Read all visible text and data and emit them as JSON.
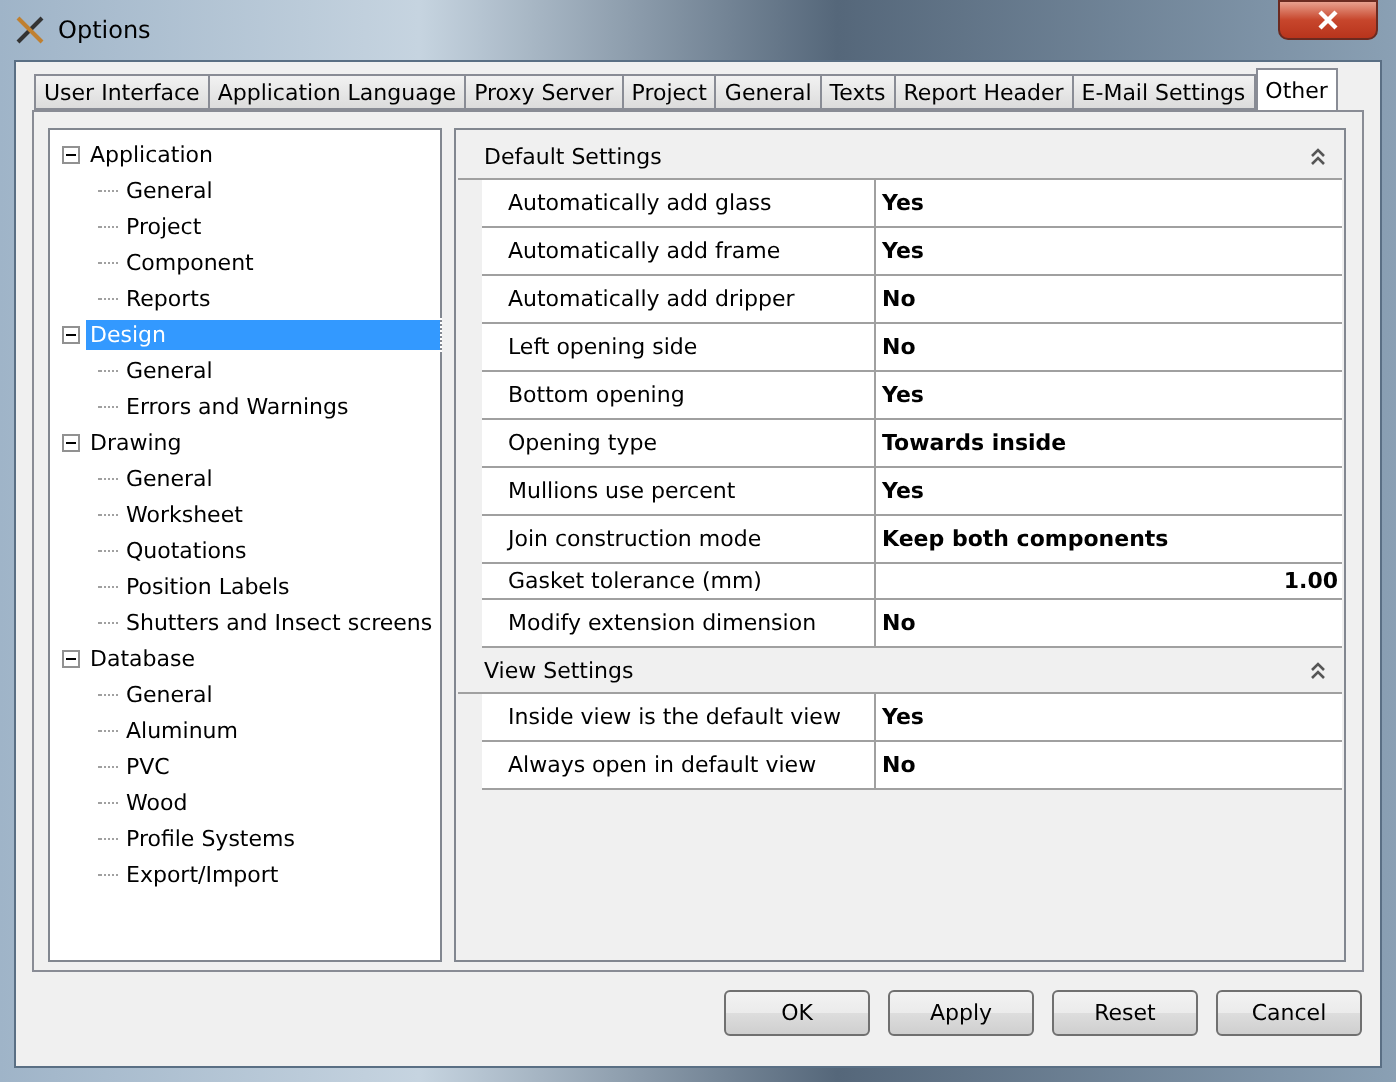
{
  "window": {
    "title": "Options"
  },
  "tabs": [
    {
      "label": "User Interface",
      "selected": false
    },
    {
      "label": "Application Language",
      "selected": false
    },
    {
      "label": "Proxy Server",
      "selected": false
    },
    {
      "label": "Project",
      "selected": false
    },
    {
      "label": "General",
      "selected": false
    },
    {
      "label": "Texts",
      "selected": false
    },
    {
      "label": "Report Header",
      "selected": false
    },
    {
      "label": "E-Mail Settings",
      "selected": false
    },
    {
      "label": "Other",
      "selected": true
    }
  ],
  "tree": [
    {
      "label": "Application",
      "expanded": true,
      "selected": false,
      "children": [
        {
          "label": "General",
          "selected": false
        },
        {
          "label": "Project",
          "selected": false
        },
        {
          "label": "Component",
          "selected": false
        },
        {
          "label": "Reports",
          "selected": false
        }
      ]
    },
    {
      "label": "Design",
      "expanded": true,
      "selected": true,
      "children": [
        {
          "label": "General",
          "selected": false
        },
        {
          "label": "Errors and Warnings",
          "selected": false
        }
      ]
    },
    {
      "label": "Drawing",
      "expanded": true,
      "selected": false,
      "children": [
        {
          "label": "General",
          "selected": false
        },
        {
          "label": "Worksheet",
          "selected": false
        },
        {
          "label": "Quotations",
          "selected": false
        },
        {
          "label": "Position Labels",
          "selected": false
        },
        {
          "label": "Shutters and Insect screens",
          "selected": false
        }
      ]
    },
    {
      "label": "Database",
      "expanded": true,
      "selected": false,
      "children": [
        {
          "label": "General",
          "selected": false
        },
        {
          "label": "Aluminum",
          "selected": false
        },
        {
          "label": "PVC",
          "selected": false
        },
        {
          "label": "Wood",
          "selected": false
        },
        {
          "label": "Profile Systems",
          "selected": false
        },
        {
          "label": "Export/Import",
          "selected": false
        }
      ]
    }
  ],
  "property_grid": [
    {
      "title": "Default Settings",
      "expanded": true,
      "rows": [
        {
          "name": "Automatically add glass",
          "value": "Yes",
          "kind": "text"
        },
        {
          "name": "Automatically add frame",
          "value": "Yes",
          "kind": "text"
        },
        {
          "name": "Automatically add dripper",
          "value": "No",
          "kind": "text"
        },
        {
          "name": "Left opening side",
          "value": "No",
          "kind": "text"
        },
        {
          "name": "Bottom opening",
          "value": "Yes",
          "kind": "text"
        },
        {
          "name": "Opening type",
          "value": "Towards inside",
          "kind": "text"
        },
        {
          "name": "Mullions use percent",
          "value": "Yes",
          "kind": "text"
        },
        {
          "name": "Join construction mode",
          "value": "Keep both components",
          "kind": "text"
        },
        {
          "name": "Gasket tolerance (mm)",
          "value": "1.00",
          "kind": "number"
        },
        {
          "name": "Modify extension dimension",
          "value": "No",
          "kind": "text"
        }
      ]
    },
    {
      "title": "View Settings",
      "expanded": true,
      "rows": [
        {
          "name": "Inside view is the default view",
          "value": "Yes",
          "kind": "text"
        },
        {
          "name": "Always open in default view",
          "value": "No",
          "kind": "text"
        }
      ]
    }
  ],
  "buttons": [
    "OK",
    "Apply",
    "Reset",
    "Cancel"
  ]
}
